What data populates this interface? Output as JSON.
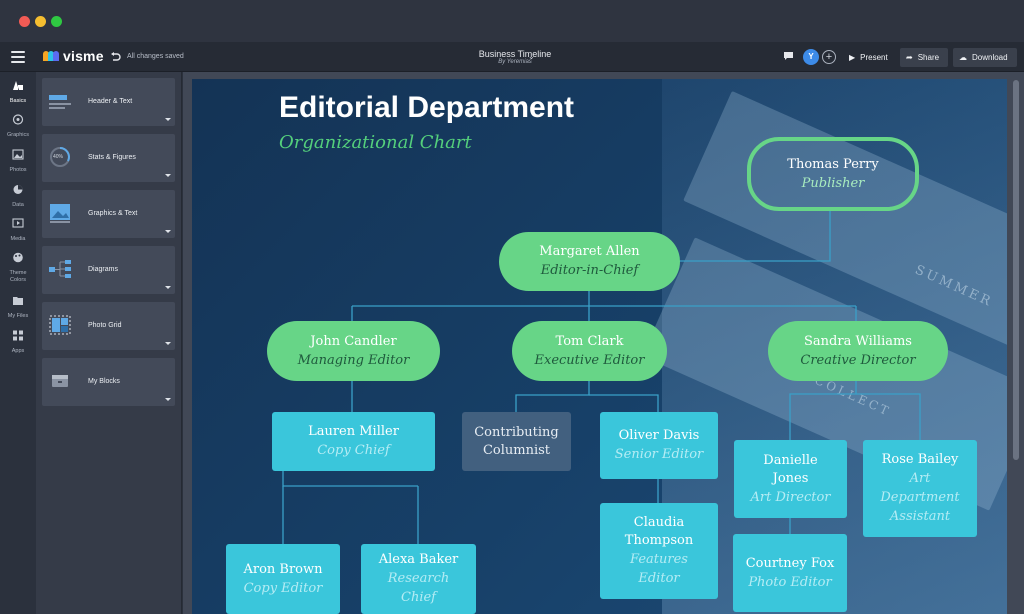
{
  "app": {
    "logo": "visme",
    "save_status": "All changes saved",
    "doc_title": "Business Timeline",
    "doc_author": "By Yeremias",
    "avatar_initial": "Y",
    "buttons": {
      "present": "Present",
      "share": "Share",
      "download": "Download"
    }
  },
  "rail": [
    {
      "label": "Basics",
      "icon": "basics-icon"
    },
    {
      "label": "Graphics",
      "icon": "graphics-icon"
    },
    {
      "label": "Photos",
      "icon": "photos-icon"
    },
    {
      "label": "Data",
      "icon": "data-icon"
    },
    {
      "label": "Media",
      "icon": "media-icon"
    },
    {
      "label": "Theme",
      "label2": "Colors",
      "icon": "palette-icon"
    },
    {
      "label": "My Files",
      "icon": "files-icon"
    },
    {
      "label": "Apps",
      "icon": "apps-icon"
    }
  ],
  "panel": {
    "cards": [
      {
        "label": "Header & Text",
        "icon": "header-text-icon"
      },
      {
        "label": "Stats & Figures",
        "icon": "stats-icon",
        "badge": "40%"
      },
      {
        "label": "Graphics & Text",
        "icon": "graphics-text-icon"
      },
      {
        "label": "Diagrams",
        "icon": "diagrams-icon"
      },
      {
        "label": "Photo Grid",
        "icon": "photo-grid-icon"
      },
      {
        "label": "My Blocks",
        "icon": "blocks-icon"
      }
    ]
  },
  "slide": {
    "title": "Editorial Department",
    "subtitle": "Organizational Chart",
    "deco_texts": [
      "SUMMER",
      "COLLECT"
    ],
    "nodes": {
      "publisher": {
        "name": "Thomas Perry",
        "role": "Publisher"
      },
      "eic": {
        "name": "Margaret Allen",
        "role": "Editor-in-Chief"
      },
      "managing": {
        "name": "John Candler",
        "role": "Managing Editor"
      },
      "executive": {
        "name": "Tom Clark",
        "role": "Executive Editor"
      },
      "creative": {
        "name": "Sandra Williams",
        "role": "Creative Director"
      },
      "copychief": {
        "name": "Lauren Miller",
        "role": "Copy Chief"
      },
      "columnist": {
        "name": "Contributing",
        "name2": "Columnist"
      },
      "senior": {
        "name": "Oliver Davis",
        "role": "Senior Editor"
      },
      "artdir": {
        "name": "Danielle",
        "name2": "Jones",
        "role": "Art Director"
      },
      "artasst": {
        "name": "Rose Bailey",
        "role": "Art",
        "role2": "Department",
        "role3": "Assistant"
      },
      "copyeditor": {
        "name": "Aron Brown",
        "role": "Copy Editor"
      },
      "research": {
        "name": "Alexa Baker",
        "role": "Research",
        "role2": "Chief"
      },
      "features": {
        "name": "Claudia",
        "name2": "Thompson",
        "role": "Features",
        "role2": "Editor"
      },
      "photo": {
        "name": "Courtney Fox",
        "role": "Photo Editor"
      }
    }
  }
}
